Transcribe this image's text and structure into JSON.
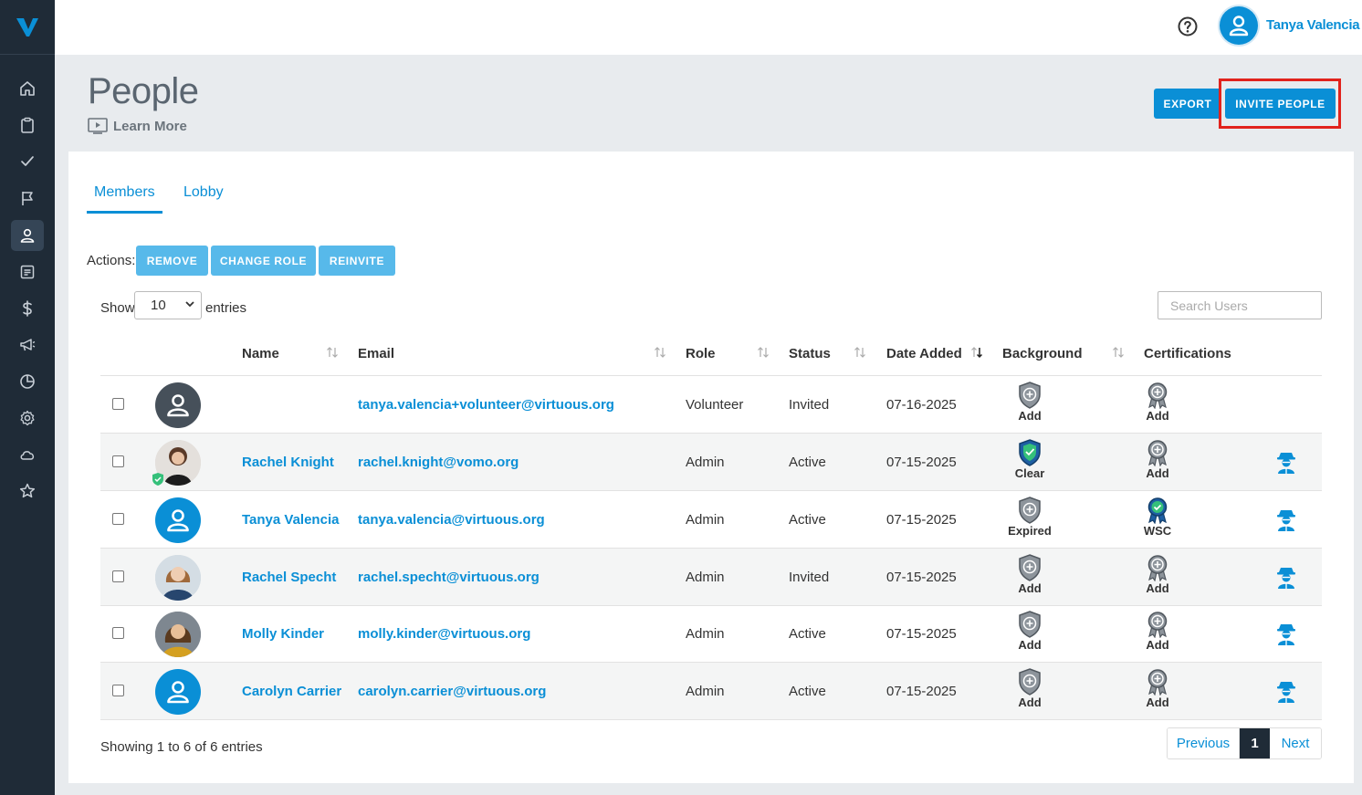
{
  "user": {
    "name": "Tanya Valencia"
  },
  "page": {
    "title": "People",
    "learn_more": "Learn More"
  },
  "header_buttons": {
    "export": "EXPORT",
    "invite": "INVITE PEOPLE"
  },
  "tabs": [
    {
      "label": "Members",
      "active": true
    },
    {
      "label": "Lobby",
      "active": false
    }
  ],
  "actions": {
    "label": "Actions:",
    "remove": "REMOVE",
    "change_role": "CHANGE ROLE",
    "reinvite": "REINVITE"
  },
  "table_controls": {
    "show": "Show",
    "entries_value": "10",
    "entries": "entries",
    "search_placeholder": "Search Users"
  },
  "columns": {
    "name": "Name",
    "email": "Email",
    "role": "Role",
    "status": "Status",
    "date_added": "Date Added",
    "background": "Background",
    "certifications": "Certifications"
  },
  "rows": [
    {
      "name": "",
      "email": "tanya.valencia+volunteer@virtuous.org",
      "role": "Volunteer",
      "status": "Invited",
      "date": "07-16-2025",
      "background": "Add",
      "cert": "Add",
      "avatar": "default-grey-avatar",
      "agent": false
    },
    {
      "name": "Rachel Knight",
      "email": "rachel.knight@vomo.org",
      "role": "Admin",
      "status": "Active",
      "date": "07-15-2025",
      "background": "Clear",
      "cert": "Add",
      "avatar": "photo",
      "agent": true
    },
    {
      "name": "Tanya Valencia",
      "email": "tanya.valencia@virtuous.org",
      "role": "Admin",
      "status": "Active",
      "date": "07-15-2025",
      "background": "Expired",
      "cert": "WSC",
      "avatar": "default-blue-avatar",
      "agent": true
    },
    {
      "name": "Rachel Specht",
      "email": "rachel.specht@virtuous.org",
      "role": "Admin",
      "status": "Invited",
      "date": "07-15-2025",
      "background": "Add",
      "cert": "Add",
      "avatar": "photo",
      "agent": true
    },
    {
      "name": "Molly Kinder",
      "email": "molly.kinder@virtuous.org",
      "role": "Admin",
      "status": "Active",
      "date": "07-15-2025",
      "background": "Add",
      "cert": "Add",
      "avatar": "photo",
      "agent": true
    },
    {
      "name": "Carolyn Carrier",
      "email": "carolyn.carrier@virtuous.org",
      "role": "Admin",
      "status": "Active",
      "date": "07-15-2025",
      "background": "Add",
      "cert": "Add",
      "avatar": "default-blue-avatar",
      "agent": true
    }
  ],
  "footer": {
    "info": "Showing 1 to 6 of 6 entries",
    "previous": "Previous",
    "page": "1",
    "next": "Next"
  },
  "colors": {
    "sidebar": "#1f2b37",
    "accent": "#0a8fd6",
    "highlight": "#e1221c"
  }
}
